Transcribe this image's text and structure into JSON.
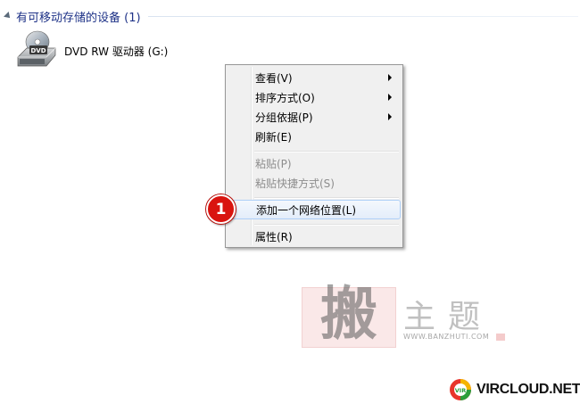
{
  "group": {
    "title": "有可移动存储的设备 (1)"
  },
  "drive": {
    "icon": "dvd-drive-icon",
    "icon_text": "DVD",
    "label": "DVD RW 驱动器 (G:)"
  },
  "context_menu": {
    "items": [
      {
        "label": "查看(V)",
        "submenu": true,
        "disabled": false
      },
      {
        "label": "排序方式(O)",
        "submenu": true,
        "disabled": false
      },
      {
        "label": "分组依据(P)",
        "submenu": true,
        "disabled": false
      },
      {
        "label": "刷新(E)",
        "submenu": false,
        "disabled": false
      },
      {
        "label": "粘贴(P)",
        "submenu": false,
        "disabled": true
      },
      {
        "label": "粘贴快捷方式(S)",
        "submenu": false,
        "disabled": true
      },
      {
        "label": "添加一个网络位置(L)",
        "submenu": false,
        "disabled": false,
        "highlighted": true
      },
      {
        "label": "属性(R)",
        "submenu": false,
        "disabled": false
      }
    ]
  },
  "step_badge": {
    "number": "1",
    "color": "#d9140f"
  },
  "watermark": {
    "seal_char": "搬",
    "text": "主题",
    "url": "WWW.BANZHUTI.COM"
  },
  "logo": {
    "badge_text": "VIR",
    "text": "VIRCLOUD.NET"
  }
}
